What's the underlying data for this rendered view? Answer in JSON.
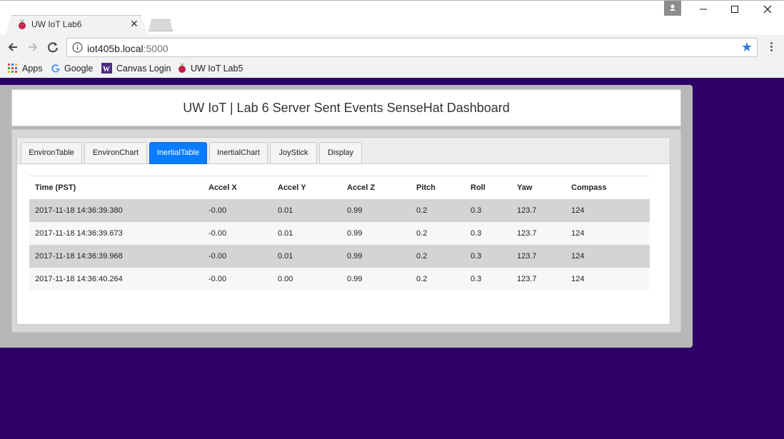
{
  "browser": {
    "tab_title": "UW IoT Lab6",
    "url_host": "iot405b.local",
    "url_port": ":5000",
    "bookmarks": [
      "Apps",
      "Google",
      "Canvas Login",
      "UW IoT Lab5"
    ],
    "icons": [
      "raspberry-icon",
      "close-icon",
      "back-icon",
      "forward-icon",
      "reload-icon",
      "info-icon",
      "star-icon",
      "menu-icon",
      "apps-icon",
      "google-icon",
      "canvas-icon"
    ],
    "accent": "#2f79e8"
  },
  "page": {
    "title": "UW IoT | Lab 6 Server Sent Events SenseHat Dashboard",
    "background": "#2e0266",
    "tabs": [
      "EnvironTable",
      "EnvironChart",
      "InertialTable",
      "InertialChart",
      "JoyStick",
      "Display"
    ],
    "active_tab": "InertialTable",
    "active_color": "#0a7cff"
  },
  "table": {
    "headers": [
      "Time (PST)",
      "Accel X",
      "Accel Y",
      "Accel Z",
      "Pitch",
      "Roll",
      "Yaw",
      "Compass"
    ],
    "rows": [
      [
        "2017-11-18 14:36:39.380",
        "-0.00",
        "0.01",
        "0.99",
        "0.2",
        "0.3",
        "123.7",
        "124"
      ],
      [
        "2017-11-18 14:36:39.673",
        "-0.00",
        "0.01",
        "0.99",
        "0.2",
        "0.3",
        "123.7",
        "124"
      ],
      [
        "2017-11-18 14:36:39.968",
        "-0.00",
        "0.01",
        "0.99",
        "0.2",
        "0.3",
        "123.7",
        "124"
      ],
      [
        "2017-11-18 14:36:40.264",
        "-0.00",
        "0.00",
        "0.99",
        "0.2",
        "0.3",
        "123.7",
        "124"
      ]
    ]
  }
}
